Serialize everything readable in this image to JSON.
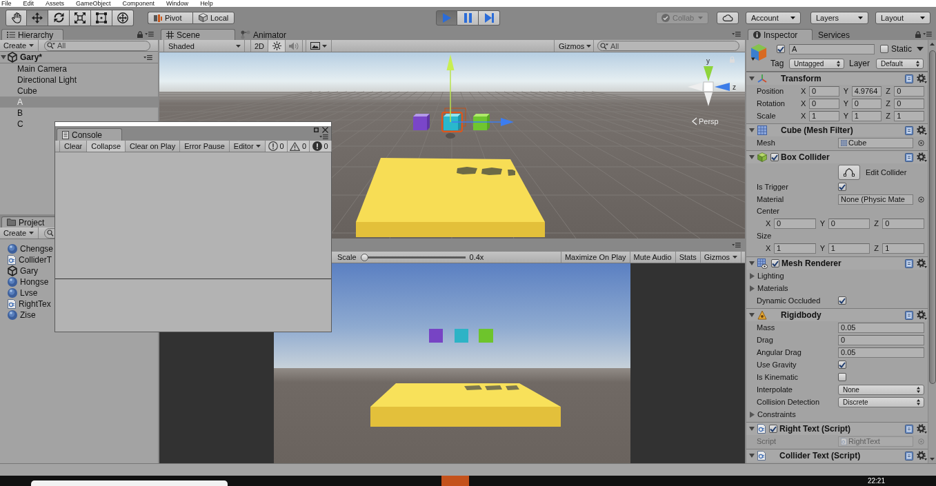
{
  "menu_bar": [
    "File",
    "Edit",
    "Assets",
    "GameObject",
    "Component",
    "Window",
    "Help"
  ],
  "toolbar": {
    "tools": [
      {
        "kind": "hand",
        "selected": false
      },
      {
        "kind": "move",
        "selected": true
      },
      {
        "kind": "rotate",
        "selected": false
      },
      {
        "kind": "scale",
        "selected": false
      },
      {
        "kind": "rect",
        "selected": false
      },
      {
        "kind": "transform",
        "selected": false
      }
    ],
    "handles": [
      {
        "kind": "pivot",
        "label": "Pivot"
      },
      {
        "kind": "local",
        "label": "Local"
      }
    ],
    "playback": [
      {
        "kind": "play",
        "selected": true
      },
      {
        "kind": "pause",
        "selected": false
      },
      {
        "kind": "step",
        "selected": false
      }
    ],
    "collab": {
      "label": "Collab",
      "disabled": true
    },
    "account": "Account",
    "layers": "Layers",
    "layout": "Layout"
  },
  "hierarchy": {
    "tab": "Hierarchy",
    "create": "Create",
    "search_placeholder": "All",
    "scene": {
      "name": "Gary*",
      "expanded": true,
      "children": [
        {
          "name": "Main Camera",
          "selected": false
        },
        {
          "name": "Directional Light",
          "selected": false
        },
        {
          "name": "Cube",
          "selected": false
        },
        {
          "name": "A",
          "selected": true
        },
        {
          "name": "B",
          "selected": false
        },
        {
          "name": "C",
          "selected": false
        }
      ]
    }
  },
  "project": {
    "tab": "Project",
    "create": "Create",
    "assets": [
      {
        "kind": "material",
        "name": "Chengse"
      },
      {
        "kind": "script",
        "name": "ColliderT"
      },
      {
        "kind": "scene",
        "name": "Gary"
      },
      {
        "kind": "material",
        "name": "Hongse"
      },
      {
        "kind": "material",
        "name": "Lvse"
      },
      {
        "kind": "script",
        "name": "RightTex"
      },
      {
        "kind": "material",
        "name": "Zise"
      }
    ]
  },
  "scene_view": {
    "tabs": [
      {
        "kind": "scene",
        "label": "Scene",
        "selected": true
      },
      {
        "kind": "animator",
        "label": "Animator",
        "selected": false
      }
    ],
    "shading": "Shaded",
    "mode_2d": "2D",
    "lighting": {
      "on": true
    },
    "audio": {
      "on": false
    },
    "gizmos": "Gizmos",
    "search_placeholder": "All",
    "axis_labels": [
      "y",
      "z"
    ],
    "projection": "Persp"
  },
  "game_view": {
    "scale_label": "Scale",
    "scale": {
      "level": 0
    },
    "scale_value": "0.4x",
    "buttons": [
      {
        "kind": "toggle",
        "label": "Maximize On Play"
      },
      {
        "kind": "toggle",
        "label": "Mute Audio"
      },
      {
        "kind": "toggle",
        "label": "Stats"
      },
      {
        "kind": "dropdown",
        "label": "Gizmos"
      }
    ]
  },
  "console": {
    "tab": "Console",
    "buttons": [
      {
        "label": "Clear",
        "on": false
      },
      {
        "label": "Collapse",
        "on": true
      },
      {
        "label": "Clear on Play",
        "on": false
      },
      {
        "label": "Error Pause",
        "on": false
      }
    ],
    "editor": "Editor",
    "counts": [
      {
        "kind": "info",
        "count": "0",
        "on": true
      },
      {
        "kind": "warning",
        "count": "0",
        "on": true
      },
      {
        "kind": "error",
        "count": "0",
        "on": true
      }
    ]
  },
  "inspector": {
    "tabs": [
      {
        "kind": "inspector",
        "label": "Inspector",
        "selected": true
      },
      {
        "kind": "services",
        "label": "Services",
        "selected": false
      }
    ],
    "object": {
      "active": true,
      "name": "A",
      "static": false,
      "static_label": "Static",
      "tag_label": "Tag",
      "tag": "Untagged",
      "layer_label": "Layer",
      "layer": "Default"
    },
    "components": [
      {
        "kind": "transform",
        "title": "Transform",
        "expanded": true,
        "rows": [
          {
            "kind": "vector3",
            "label": "Position",
            "values": [
              {
                "axis": "X",
                "value": "0"
              },
              {
                "axis": "Y",
                "value": "4.9764"
              },
              {
                "axis": "Z",
                "value": "0"
              }
            ]
          },
          {
            "kind": "vector3",
            "label": "Rotation",
            "values": [
              {
                "axis": "X",
                "value": "0"
              },
              {
                "axis": "Y",
                "value": "0"
              },
              {
                "axis": "Z",
                "value": "0"
              }
            ]
          },
          {
            "kind": "vector3",
            "label": "Scale",
            "values": [
              {
                "axis": "X",
                "value": "1"
              },
              {
                "axis": "Y",
                "value": "1"
              },
              {
                "axis": "Z",
                "value": "1"
              }
            ]
          }
        ]
      },
      {
        "kind": "mesh_filter",
        "title": "Cube (Mesh Filter)",
        "expanded": true,
        "rows": [
          {
            "kind": "mesh_field",
            "label": "Mesh",
            "value": "Cube"
          }
        ]
      },
      {
        "kind": "box_collider",
        "title": "Box Collider",
        "enabled": true,
        "expanded": true,
        "rows": [
          {
            "kind": "edit_button",
            "label": "Edit Collider"
          },
          {
            "kind": "checkbox",
            "label": "Is Trigger",
            "checked": true
          },
          {
            "kind": "object_field",
            "label": "Material",
            "value": "None (Physic Mate"
          },
          {
            "kind": "vector3_block",
            "label": "Center",
            "values": [
              {
                "axis": "X",
                "value": "0"
              },
              {
                "axis": "Y",
                "value": "0"
              },
              {
                "axis": "Z",
                "value": "0"
              }
            ]
          },
          {
            "kind": "vector3_block",
            "label": "Size",
            "values": [
              {
                "axis": "X",
                "value": "1"
              },
              {
                "axis": "Y",
                "value": "1"
              },
              {
                "axis": "Z",
                "value": "1"
              }
            ]
          }
        ]
      },
      {
        "kind": "mesh_renderer",
        "title": "Mesh Renderer",
        "enabled": true,
        "expanded": true,
        "rows": [
          {
            "kind": "foldout",
            "label": "Lighting",
            "expanded": false
          },
          {
            "kind": "foldout",
            "label": "Materials",
            "expanded": false
          },
          {
            "kind": "checkbox",
            "label": "Dynamic Occluded",
            "checked": true
          }
        ]
      },
      {
        "kind": "rigidbody",
        "title": "Rigidbody",
        "expanded": true,
        "rows": [
          {
            "kind": "number",
            "label": "Mass",
            "value": "0.05"
          },
          {
            "kind": "number",
            "label": "Drag",
            "value": "0"
          },
          {
            "kind": "number",
            "label": "Angular Drag",
            "value": "0.05"
          },
          {
            "kind": "checkbox",
            "label": "Use Gravity",
            "checked": true
          },
          {
            "kind": "checkbox",
            "label": "Is Kinematic",
            "checked": false
          },
          {
            "kind": "dropdown",
            "label": "Interpolate",
            "value": "None"
          },
          {
            "kind": "dropdown",
            "label": "Collision Detection",
            "value": "Discrete"
          },
          {
            "kind": "foldout",
            "label": "Constraints",
            "expanded": false
          }
        ]
      },
      {
        "kind": "script",
        "title": "Right Text (Script)",
        "enabled": true,
        "expanded": true,
        "rows": [
          {
            "kind": "script_field",
            "label": "Script",
            "value": "RightText",
            "disabled": true
          }
        ]
      },
      {
        "kind": "script",
        "title": "Collider Text (Script)",
        "expanded": true
      }
    ]
  },
  "taskbar": {
    "clock": "22:21"
  }
}
